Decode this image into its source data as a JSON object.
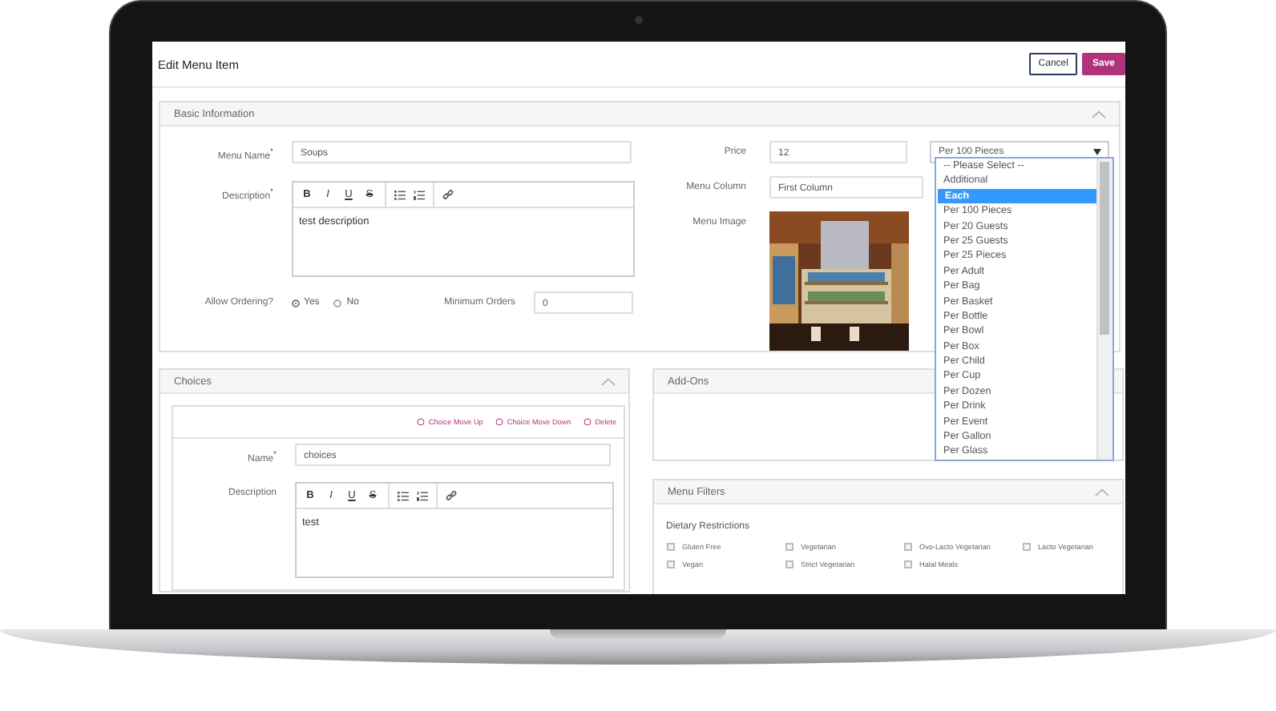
{
  "screen": {
    "title": "Edit Menu Item",
    "buttons": [
      {
        "label": "Cancel",
        "kind": "secondary"
      },
      {
        "label": "Save",
        "kind": "primary"
      }
    ]
  },
  "basic_information": {
    "title": "Basic Information",
    "menu_name": {
      "label": "Menu Name$^{*}$",
      "value": "Soups"
    },
    "description": {
      "label": "Description$^{*}$",
      "toolbar": [
        "B",
        "I",
        "U",
        "S"
      ],
      "value": "test description"
    },
    "allow_ordering": {
      "label": "Allow Ordering?",
      "options": [
        {
          "label": "Yes",
          "selected": true
        },
        {
          "label": "No",
          "selected": false
        }
      ]
    },
    "minimum_orders": {
      "label": "Minimum Orders",
      "value": "0"
    },
    "price": {
      "label": "Price",
      "value": "12",
      "unit": "Per 100 Pieces"
    },
    "menu_column": {
      "label": "Menu Column",
      "value": "First Column"
    },
    "menu_image": {
      "label": "Menu Image",
      "kind": "picture"
    }
  },
  "unit_dropdown": {
    "options": [
      {
        "label": "-- Please Select --",
        "selected": false
      },
      {
        "label": "Additional",
        "selected": false
      },
      {
        "label": "Each",
        "selected": true
      },
      {
        "label": "Per 100 Pieces",
        "selected": false
      },
      {
        "label": "Per 20 Guests",
        "selected": false
      },
      {
        "label": "Per 25 Guests",
        "selected": false
      },
      {
        "label": "Per 25 Pieces",
        "selected": false
      },
      {
        "label": "Per Adult",
        "selected": false
      },
      {
        "label": "Per Bag",
        "selected": false
      },
      {
        "label": "Per Basket",
        "selected": false
      },
      {
        "label": "Per Bottle",
        "selected": false
      },
      {
        "label": "Per Bowl",
        "selected": false
      },
      {
        "label": "Per Box",
        "selected": false
      },
      {
        "label": "Per Child",
        "selected": false
      },
      {
        "label": "Per Cup",
        "selected": false
      },
      {
        "label": "Per Dozen",
        "selected": false
      },
      {
        "label": "Per Drink",
        "selected": false
      },
      {
        "label": "Per Event",
        "selected": false
      },
      {
        "label": "Per Gallon",
        "selected": false
      },
      {
        "label": "Per Glass",
        "selected": false
      }
    ]
  },
  "choices": {
    "title": "Choices",
    "actions": [
      "Choice Move Up",
      "Choice Move Down",
      "Delete"
    ],
    "name": {
      "label": "Name$^{*}$",
      "value": "choices"
    },
    "description": {
      "label": "Description",
      "toolbar": [
        "B",
        "I",
        "U",
        "S"
      ],
      "value": "test"
    }
  },
  "add_ons": {
    "title": "Add-Ons"
  },
  "menu_filters": {
    "title": "Menu Filters",
    "group": "Dietary Restrictions",
    "options": [
      {
        "label": "Gluten Free",
        "checked": false
      },
      {
        "label": "Vegetarian",
        "checked": false
      },
      {
        "label": "Ovo-Lacto Vegetarian",
        "checked": false
      },
      {
        "label": "Lacto Vegetarian",
        "checked": false
      },
      {
        "label": "Vegan",
        "checked": false
      },
      {
        "label": "Strict Vegetarian",
        "checked": false
      },
      {
        "label": "Halal Meals",
        "checked": false
      }
    ]
  }
}
